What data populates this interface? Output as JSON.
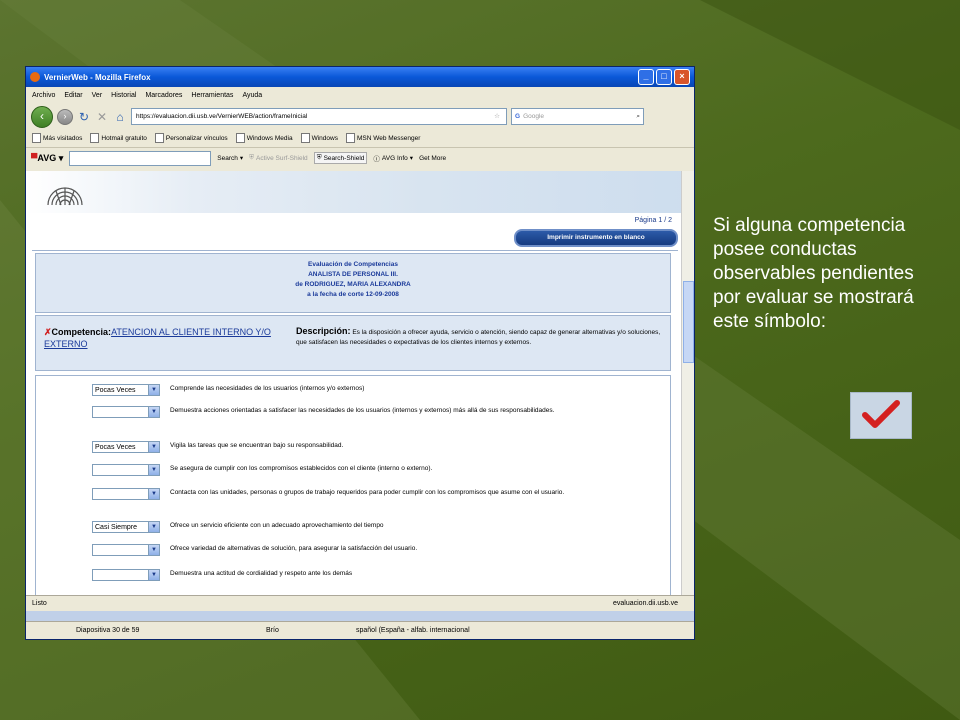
{
  "slide": {
    "caption": "Si alguna competencia posee conductas observables pendientes por evaluar se mostrará este símbolo:",
    "check_icon": "checkmark-icon"
  },
  "window": {
    "title": "VernierWeb - Mozilla Firefox",
    "menu": [
      "Archivo",
      "Editar",
      "Ver",
      "Historial",
      "Marcadores",
      "Herramientas",
      "Ayuda"
    ],
    "url": "https://evaluacion.dii.usb.ve/VernierWEB/action/frameInicial",
    "search_placeholder": "Google",
    "bookmarks": [
      "Más visitados",
      "Hotmail gratuito",
      "Personalizar vínculos",
      "Windows Media",
      "Windows",
      "MSN Web Messenger"
    ],
    "avg": {
      "logo": "AVG",
      "search": "Search",
      "active_surf": "Active Surf-Shield",
      "search_shield": "Search-Shield",
      "avg_info": "AVG Info",
      "get_more": "Get More"
    },
    "status_left": "Listo",
    "status_right": "evaluacion.dii.usb.ve"
  },
  "page": {
    "pagination": "Página 1 / 2",
    "print_button": "Imprimir instrumento en blanco",
    "header": {
      "line1": "Evaluación de Competencias",
      "line2": "ANALISTA DE PERSONAL III.",
      "line3": "de RODRIGUEZ, MARIA ALEXANDRA",
      "line4": "a la fecha de corte 12-09-2008"
    },
    "competencia_label": "Competencia:",
    "competencia_value": "ATENCION AL CLIENTE INTERNO Y/O EXTERNO",
    "descripcion_label": "Descripción:",
    "descripcion_text": "Es la disposición a ofrecer ayuda, servicio o atención, siendo capaz de generar alternativas y/o soluciones, que satisfacen las necesidades o expectativas de los clientes internos y externos.",
    "items": [
      {
        "select": "Pocas Veces",
        "text": "Comprende las necesidades de los usuarios (internos y/o externos)"
      },
      {
        "select": "",
        "text": "Demuestra acciones orientadas a satisfacer las necesidades de los usuarios (internos y externos) más allá de sus responsabilidades."
      },
      {
        "select": "Pocas Veces",
        "text": "Vigila las tareas que se encuentran bajo su responsabilidad."
      },
      {
        "select": "",
        "text": "Se asegura de cumplir con los compromisos establecidos con el cliente (interno o externo)."
      },
      {
        "select": "",
        "text": "Contacta con las unidades, personas o grupos de trabajo requeridos para poder cumplir con los compromisos que asume con el usuario."
      },
      {
        "select": "Casi Siempre",
        "text": "Ofrece un servicio eficiente con un adecuado aprovechamiento del tiempo"
      },
      {
        "select": "",
        "text": "Ofrece variedad de alternativas de solución, para asegurar la satisfacción del usuario."
      },
      {
        "select": "",
        "text": "Demuestra una actitud de cordialidad y respeto ante los demás"
      }
    ]
  },
  "ppt_status": {
    "slide": "Diapositiva 30 de 59",
    "design": "Brío",
    "language": "spañol (España - alfab. internacional"
  }
}
